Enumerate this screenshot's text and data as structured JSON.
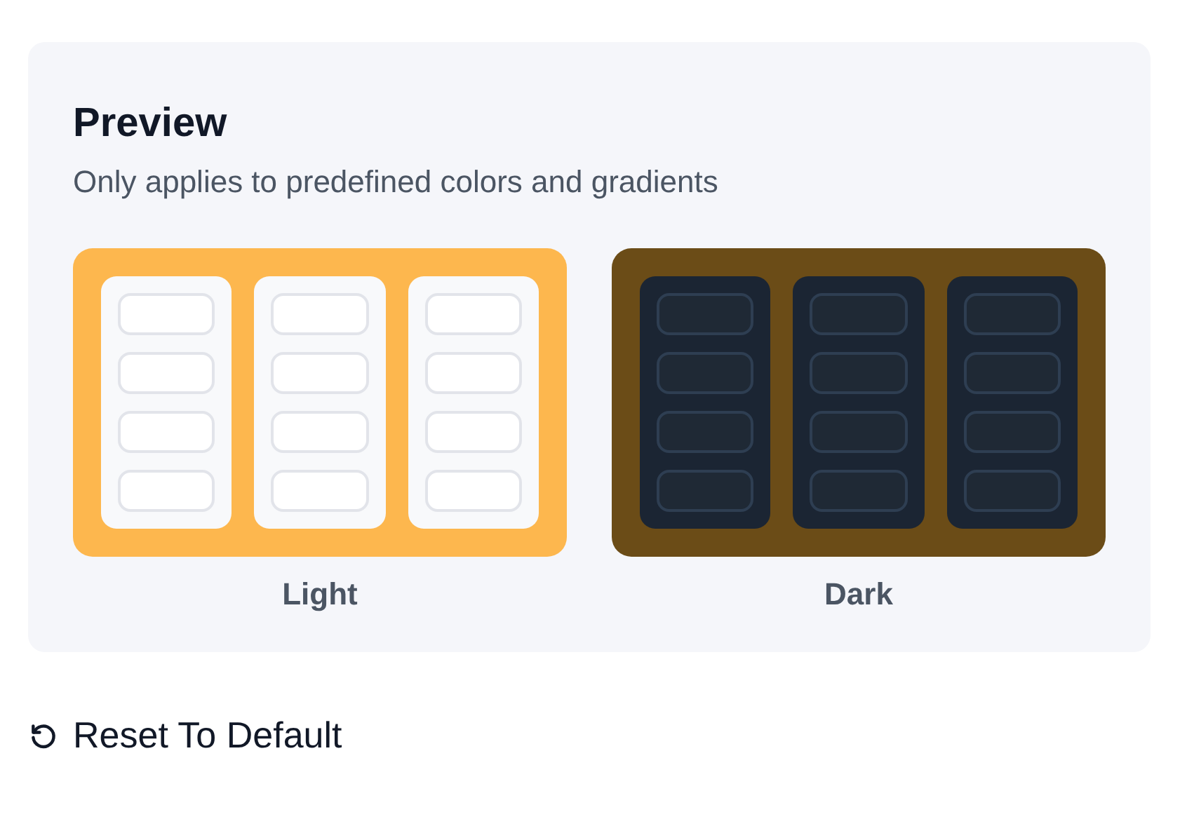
{
  "preview": {
    "title": "Preview",
    "subtitle": "Only applies to predefined colors and gradients",
    "themes": [
      {
        "kind": "light",
        "label": "Light"
      },
      {
        "kind": "dark",
        "label": "Dark"
      }
    ]
  },
  "reset_button": {
    "label": "Reset To Default"
  }
}
